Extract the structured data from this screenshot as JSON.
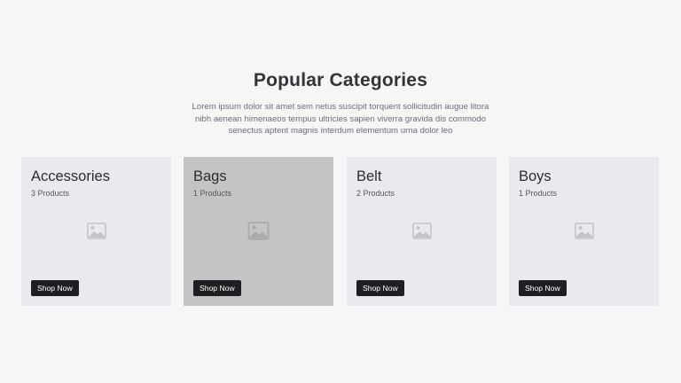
{
  "section": {
    "title": "Popular Categories",
    "description": "Lorem ipsum dolor sit amet sem netus suscipit torquent sollicitudin augue litora nibh aenean himenaeos tempus ultricies sapien viverra gravida dis commodo senectus aptent magnis interdum elementum urna dolor leo"
  },
  "categories": [
    {
      "name": "Accessories",
      "count": "3 Products",
      "button": "Shop Now",
      "icon": "image-placeholder-icon"
    },
    {
      "name": "Bags",
      "count": "1 Products",
      "button": "Shop Now",
      "icon": "image-placeholder-icon"
    },
    {
      "name": "Belt",
      "count": "2 Products",
      "button": "Shop Now",
      "icon": "image-placeholder-icon"
    },
    {
      "name": "Boys",
      "count": "1 Products",
      "button": "Shop Now",
      "icon": "image-placeholder-icon"
    }
  ],
  "colors": {
    "background": "#f6f6f6",
    "card": "#e9eaef",
    "card_hover": "#c4c4c4",
    "button": "#1f1f23"
  }
}
